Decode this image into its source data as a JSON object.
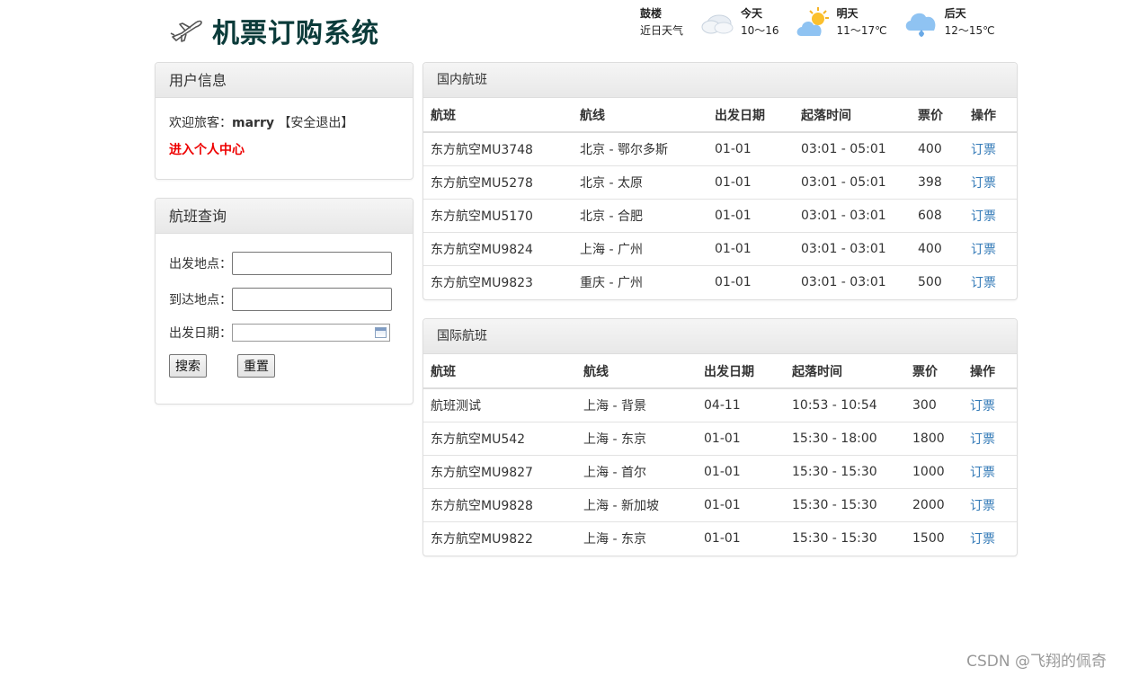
{
  "header": {
    "title": "机票订购系统"
  },
  "weather": {
    "city": "鼓楼",
    "subtitle": "近日天气",
    "days": [
      {
        "name": "今天",
        "temp": "10～16",
        "icon": "cloudy-icon"
      },
      {
        "name": "明天",
        "temp": "11～17℃",
        "icon": "partly-sunny-icon"
      },
      {
        "name": "后天",
        "temp": "12～15℃",
        "icon": "rain-cloud-icon"
      }
    ]
  },
  "user_panel": {
    "heading": "用户信息",
    "welcome_label": "欢迎旅客：",
    "username": "marry",
    "logout": "【安全退出】",
    "center_link": "进入个人中心"
  },
  "search_panel": {
    "heading": "航班查询",
    "from_label": "出发地点：",
    "from_value": "",
    "to_label": "到达地点：",
    "to_value": "",
    "date_label": "出发日期：",
    "date_value": "",
    "search_button": "搜索",
    "reset_button": "重置"
  },
  "domestic": {
    "heading": "国内航班",
    "columns": [
      "航班",
      "航线",
      "出发日期",
      "起落时间",
      "票价",
      "操作"
    ],
    "rows": [
      {
        "flight": "东方航空MU3748",
        "route": "北京 - 鄂尔多斯",
        "date": "01-01",
        "time": "03:01 - 05:01",
        "price": "400",
        "action": "订票"
      },
      {
        "flight": "东方航空MU5278",
        "route": "北京 - 太原",
        "date": "01-01",
        "time": "03:01 - 05:01",
        "price": "398",
        "action": "订票"
      },
      {
        "flight": "东方航空MU5170",
        "route": "北京 - 合肥",
        "date": "01-01",
        "time": "03:01 - 03:01",
        "price": "608",
        "action": "订票"
      },
      {
        "flight": "东方航空MU9824",
        "route": "上海 - 广州",
        "date": "01-01",
        "time": "03:01 - 03:01",
        "price": "400",
        "action": "订票"
      },
      {
        "flight": "东方航空MU9823",
        "route": "重庆 - 广州",
        "date": "01-01",
        "time": "03:01 - 03:01",
        "price": "500",
        "action": "订票"
      }
    ]
  },
  "international": {
    "heading": "国际航班",
    "columns": [
      "航班",
      "航线",
      "出发日期",
      "起落时间",
      "票价",
      "操作"
    ],
    "rows": [
      {
        "flight": "航班测试",
        "route": "上海 - 背景",
        "date": "04-11",
        "time": "10:53 - 10:54",
        "price": "300",
        "action": "订票"
      },
      {
        "flight": "东方航空MU542",
        "route": "上海 - 东京",
        "date": "01-01",
        "time": "15:30 - 18:00",
        "price": "1800",
        "action": "订票"
      },
      {
        "flight": "东方航空MU9827",
        "route": "上海 - 首尔",
        "date": "01-01",
        "time": "15:30 - 15:30",
        "price": "1000",
        "action": "订票"
      },
      {
        "flight": "东方航空MU9828",
        "route": "上海 - 新加坡",
        "date": "01-01",
        "time": "15:30 - 15:30",
        "price": "2000",
        "action": "订票"
      },
      {
        "flight": "东方航空MU9822",
        "route": "上海 - 东京",
        "date": "01-01",
        "time": "15:30 - 15:30",
        "price": "1500",
        "action": "订票"
      }
    ]
  },
  "watermark": "CSDN @飞翔的佩奇",
  "colors": {
    "title": "#0b3b3a",
    "link": "#337ab7",
    "center_link": "#ee0000"
  }
}
